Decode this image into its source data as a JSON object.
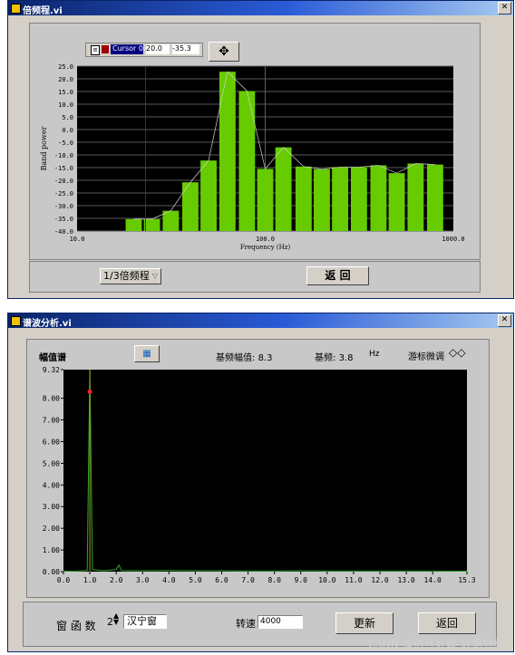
{
  "window1": {
    "title": "倍频程.vi",
    "close_glyph": "✕",
    "cursor_legend": {
      "name": "Cursor 0",
      "x_value": "20.0",
      "y_value": "-35.3"
    },
    "chart": {
      "ylabel": "Band power",
      "xlabel": "Frequency (Hz)",
      "y_ticks": [
        "25.0",
        "20.0",
        "15.0",
        "10.0",
        "5.0",
        "0.0",
        "-5.0",
        "-10.0",
        "-15.0",
        "-20.0",
        "-25.0",
        "-30.0",
        "-35.0",
        "-40.0"
      ],
      "x_ticks": [
        "10.0",
        "100.0",
        "1000.0"
      ]
    },
    "mode_select": "1/3倍频程",
    "return_button": "返 回"
  },
  "window2": {
    "title": "谱波分析.vi",
    "close_glyph": "✕",
    "header": {
      "amp_spectrum_label": "幅值谱",
      "fundamental_amp_label": "基频幅值:",
      "fundamental_amp_value": "8.3",
      "fundamental_label": "基频:",
      "fundamental_value": "3.8",
      "fundamental_unit": "Hz",
      "cursor_adjust_label": "游标微调"
    },
    "chart": {
      "y_ticks": [
        "9.32",
        "8.00",
        "7.00",
        "6.00",
        "5.00",
        "4.00",
        "3.00",
        "2.00",
        "1.00",
        "0.00"
      ],
      "x_ticks": [
        "0.0",
        "1.0",
        "2.0",
        "3.0",
        "4.0",
        "5.0",
        "6.0",
        "7.0",
        "8.0",
        "9.0",
        "10.0",
        "11.0",
        "12.0",
        "13.0",
        "14.0",
        "15.3"
      ]
    },
    "window_function_label": "窗 函 数",
    "window_function_index": "2",
    "window_function_value": "汉宁窗",
    "speed_label": "转速",
    "speed_value": "4000",
    "update_button": "更新",
    "return_button": "返回"
  },
  "watermark": "CSDN @信号处理-数据分析",
  "chart_data": [
    {
      "type": "bar",
      "xlabel": "Frequency (Hz)",
      "ylabel": "Band power",
      "x_scale": "log",
      "xlim": [
        10,
        1000
      ],
      "ylim": [
        -40,
        25
      ],
      "grid": true,
      "cursor": {
        "x": 20.0,
        "y": -35.3
      },
      "bar_color": "#66cc00",
      "categories": [
        20,
        25,
        31.5,
        40,
        50,
        63,
        80,
        100,
        125,
        160,
        200,
        250,
        315,
        400,
        500,
        630,
        800
      ],
      "values": [
        -35.3,
        -35.3,
        -32.0,
        -20.8,
        -12.2,
        22.8,
        15.2,
        -15.5,
        -7.0,
        -14.6,
        -15.6,
        -14.8,
        -14.8,
        -14.1,
        -17.2,
        -13.4,
        -13.8
      ]
    },
    {
      "type": "line",
      "xlabel": "",
      "ylabel": "",
      "xlim": [
        0,
        15.3
      ],
      "ylim": [
        0,
        9.32
      ],
      "grid": false,
      "line_color": "#2ea82e",
      "peak": {
        "x": 1.0,
        "y": 8.3
      },
      "x": [
        0,
        0.5,
        0.9,
        0.95,
        1.0,
        1.05,
        1.1,
        1.5,
        2.0,
        2.1,
        2.2,
        3.0,
        4.0,
        5.0,
        6.0,
        7.0,
        8.0,
        9.0,
        10.0,
        11.0,
        12.0,
        13.0,
        14.0,
        15.3
      ],
      "y": [
        0.02,
        0.03,
        0.05,
        4.8,
        9.32,
        4.7,
        0.1,
        0.04,
        0.1,
        0.3,
        0.05,
        0.04,
        0.05,
        0.04,
        0.04,
        0.03,
        0.03,
        0.04,
        0.03,
        0.03,
        0.03,
        0.03,
        0.03,
        0.02
      ]
    }
  ]
}
